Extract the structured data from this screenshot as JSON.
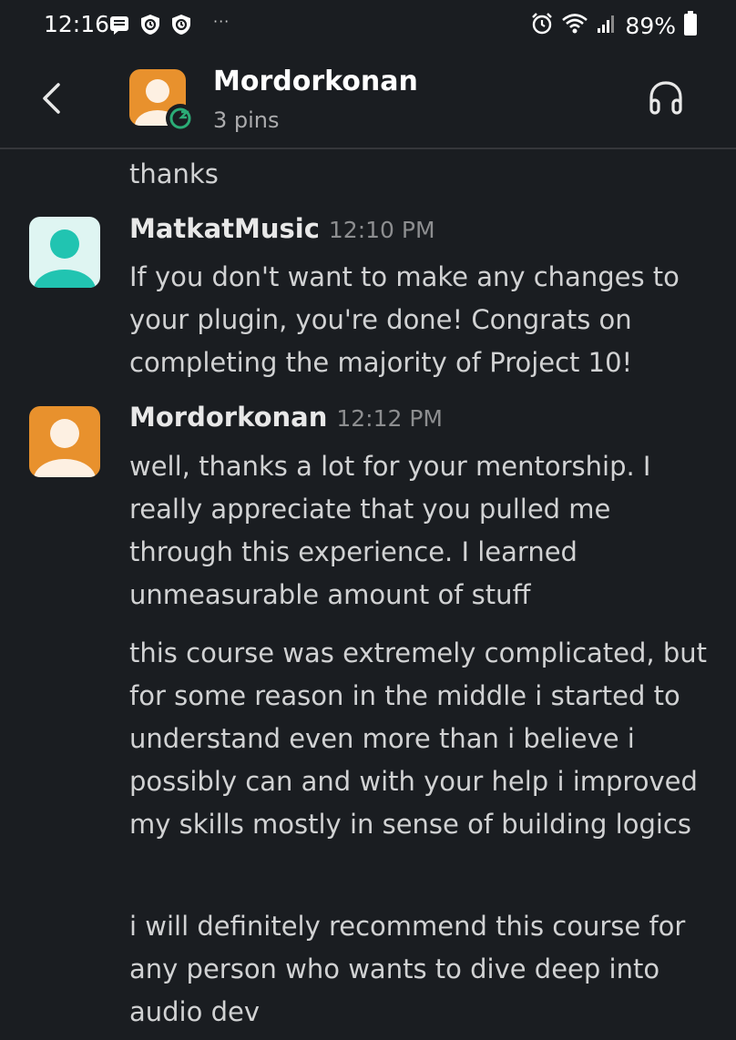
{
  "status_bar": {
    "time": "12:16",
    "battery": "89%",
    "notification_icons": [
      "message-icon",
      "shield-icon",
      "shield-icon"
    ],
    "more": "···"
  },
  "header": {
    "title": "Mordorkonan",
    "subtitle": "3 pins"
  },
  "messages": [
    {
      "text": "thanks"
    },
    {
      "author": "MatkatMusic",
      "time": "12:10 PM",
      "text": "If you don't want to make any changes to your plugin, you're done!  Congrats on completing the majority of Project 10!"
    },
    {
      "author": "Mordorkonan",
      "time": "12:12 PM",
      "text": "well, thanks a lot for your mentorship. I really appreciate that you pulled me through this experience. I learned unmeasurable amount of stuff"
    },
    {
      "text": "this course was extremely complicated, but for some reason in the middle i started to understand even more than i believe i possibly can and with your help i improved my skills mostly in sense of building logics"
    },
    {
      "text": "i will definitely recommend this course for any person who wants to dive deep into audio dev"
    }
  ],
  "colors": {
    "background": "#1a1d21",
    "avatar_orange": "#e8912d",
    "avatar_teal": "#21c4b1",
    "away_status": "#2bac76"
  }
}
